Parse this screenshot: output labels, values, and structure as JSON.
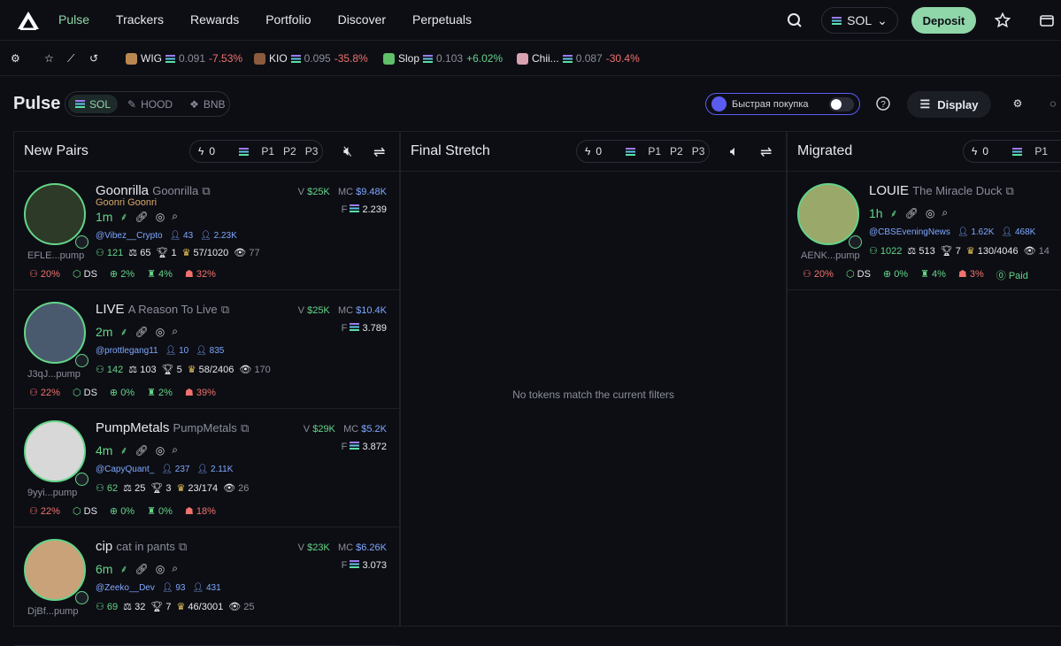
{
  "header": {
    "nav": [
      "Pulse",
      "Trackers",
      "Rewards",
      "Portfolio",
      "Discover",
      "Perpetuals"
    ],
    "chain": "SOL",
    "deposit": "Deposit"
  },
  "ticker": [
    {
      "sym": "WIG",
      "price": "0.091",
      "chg": "-7.53%",
      "pos": false,
      "color": "#b98850"
    },
    {
      "sym": "KIO",
      "price": "0.095",
      "chg": "-35.8%",
      "pos": false,
      "color": "#8b5b3e"
    },
    {
      "sym": "Slop",
      "price": "0.103",
      "chg": "+6.02%",
      "pos": true,
      "color": "#5fbf6a"
    },
    {
      "sym": "Chii...",
      "price": "0.087",
      "chg": "-30.4%",
      "pos": false,
      "color": "#d9a2b0"
    }
  ],
  "page": {
    "title": "Pulse",
    "chains": [
      "SOL",
      "HOOD",
      "BNB"
    ],
    "quick": "Быстрая покупка",
    "display": "Display"
  },
  "columns": [
    {
      "title": "New Pairs",
      "count": "0",
      "presets": [
        "P1",
        "P2",
        "P3"
      ]
    },
    {
      "title": "Final Stretch",
      "count": "0",
      "presets": [
        "P1",
        "P2",
        "P3"
      ],
      "empty": "No tokens match the current filters"
    },
    {
      "title": "Migrated",
      "count": "0",
      "presets": [
        "P1"
      ]
    }
  ],
  "new_pairs": [
    {
      "name": "Goonrilla",
      "full": "Goonrilla",
      "sub": "Goonri  Goonri",
      "age": "1m",
      "v": "$25K",
      "mc": "$9.48K",
      "f": "2.239",
      "handle": "@Vibez__Crypto",
      "h1": "43",
      "h2": "2.23K",
      "a": "121",
      "b": "65",
      "c": "1",
      "d": "57/1020",
      "e": "77",
      "addr": "EFLE...pump",
      "s1": "20%",
      "s2": "DS",
      "s3": "2%",
      "s4": "4%",
      "s5": "32%",
      "color": "#2d3a28"
    },
    {
      "name": "LIVE",
      "full": "A Reason To Live",
      "sub": "",
      "age": "2m",
      "v": "$25K",
      "mc": "$10.4K",
      "f": "3.789",
      "handle": "@prottlegang11",
      "h1": "10",
      "h2": "835",
      "a": "142",
      "b": "103",
      "c": "5",
      "d": "58/2406",
      "e": "170",
      "addr": "J3qJ...pump",
      "s1": "22%",
      "s2": "DS",
      "s3": "0%",
      "s4": "2%",
      "s5": "39%",
      "color": "#4a5a6e"
    },
    {
      "name": "PumpMetals",
      "full": "PumpMetals",
      "sub": "",
      "age": "4m",
      "v": "$29K",
      "mc": "$5.2K",
      "f": "3.872",
      "handle": "@CapyQuant_",
      "h1": "237",
      "h2": "2.11K",
      "a": "62",
      "b": "25",
      "c": "3",
      "d": "23/174",
      "e": "26",
      "addr": "9yyi...pump",
      "s1": "22%",
      "s2": "DS",
      "s3": "0%",
      "s4": "0%",
      "s5": "18%",
      "color": "#d8d8d8"
    },
    {
      "name": "cip",
      "full": "cat in pants",
      "sub": "",
      "age": "6m",
      "v": "$23K",
      "mc": "$6.26K",
      "f": "3.073",
      "handle": "@Zeeko__Dev",
      "h1": "93",
      "h2": "431",
      "a": "69",
      "b": "32",
      "c": "7",
      "d": "46/3001",
      "e": "25",
      "addr": "DjBf...pump",
      "s1": "",
      "s2": "",
      "s3": "",
      "s4": "",
      "s5": "",
      "color": "#c9a27a"
    }
  ],
  "migrated": {
    "name": "LOUIE",
    "full": "The Miracle Duck",
    "age": "1h",
    "handle": "@CBSEveningNews",
    "h1": "1.62K",
    "h2": "468K",
    "a": "1022",
    "b": "513",
    "c": "7",
    "d": "130/4046",
    "e": "14",
    "addr": "AENK...pump",
    "s1": "20%",
    "s2": "DS",
    "s3": "0%",
    "s4": "4%",
    "s5": "3%",
    "paid": "Paid",
    "color": "#9aa86a"
  }
}
